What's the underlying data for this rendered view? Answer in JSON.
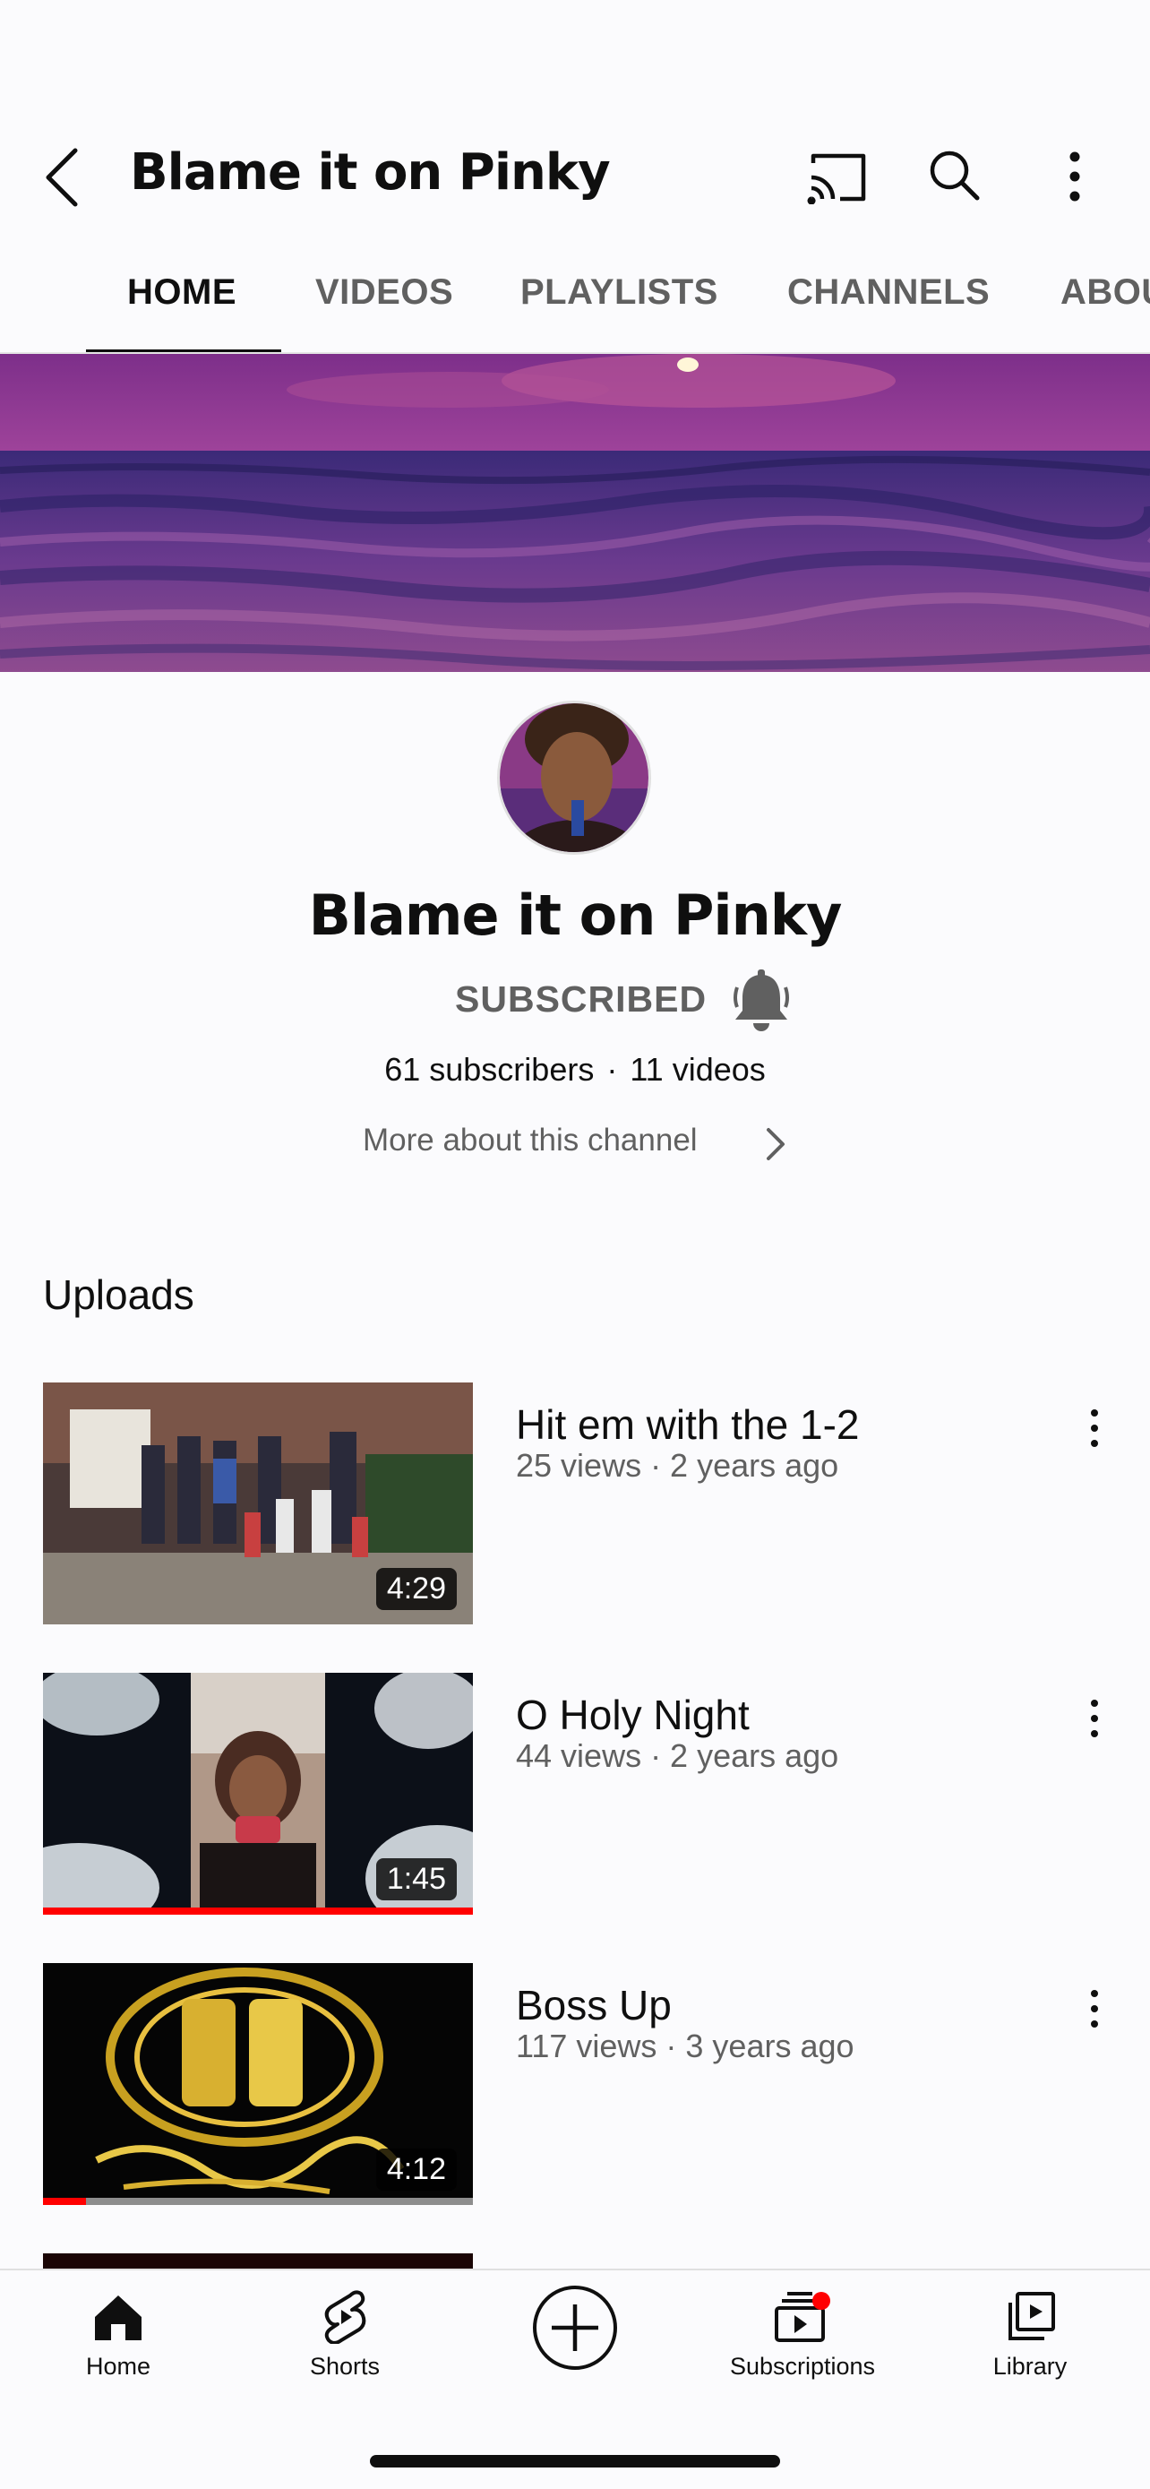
{
  "header": {
    "title": "Blame it on Pinky"
  },
  "tabs": [
    {
      "label": "HOME",
      "active": true
    },
    {
      "label": "VIDEOS"
    },
    {
      "label": "PLAYLISTS"
    },
    {
      "label": "CHANNELS"
    },
    {
      "label": "ABOUT"
    }
  ],
  "channel": {
    "name": "Blame it on Pinky",
    "subscribe_state": "SUBSCRIBED",
    "subscribers": "61 subscribers",
    "stats_separator": "·",
    "videos_count": "11 videos",
    "more_about": "More about this channel"
  },
  "uploads": {
    "title": "Uploads",
    "videos": [
      {
        "title": "Hit em with the 1-2",
        "meta": "25 views · 2 years ago",
        "duration": "4:29",
        "watched": 0
      },
      {
        "title": "O Holy Night",
        "meta": "44 views · 2 years ago",
        "duration": "1:45",
        "watched": 1.0
      },
      {
        "title": "Boss Up",
        "meta": "117 views · 3 years ago",
        "duration": "4:12",
        "watched": 0.1
      }
    ]
  },
  "bottom_nav": {
    "home": "Home",
    "shorts": "Shorts",
    "subscriptions": "Subscriptions",
    "library": "Library"
  },
  "colors": {
    "accent_red": "#ff0000",
    "text_primary": "#0f0f0f",
    "text_secondary": "#606060"
  }
}
